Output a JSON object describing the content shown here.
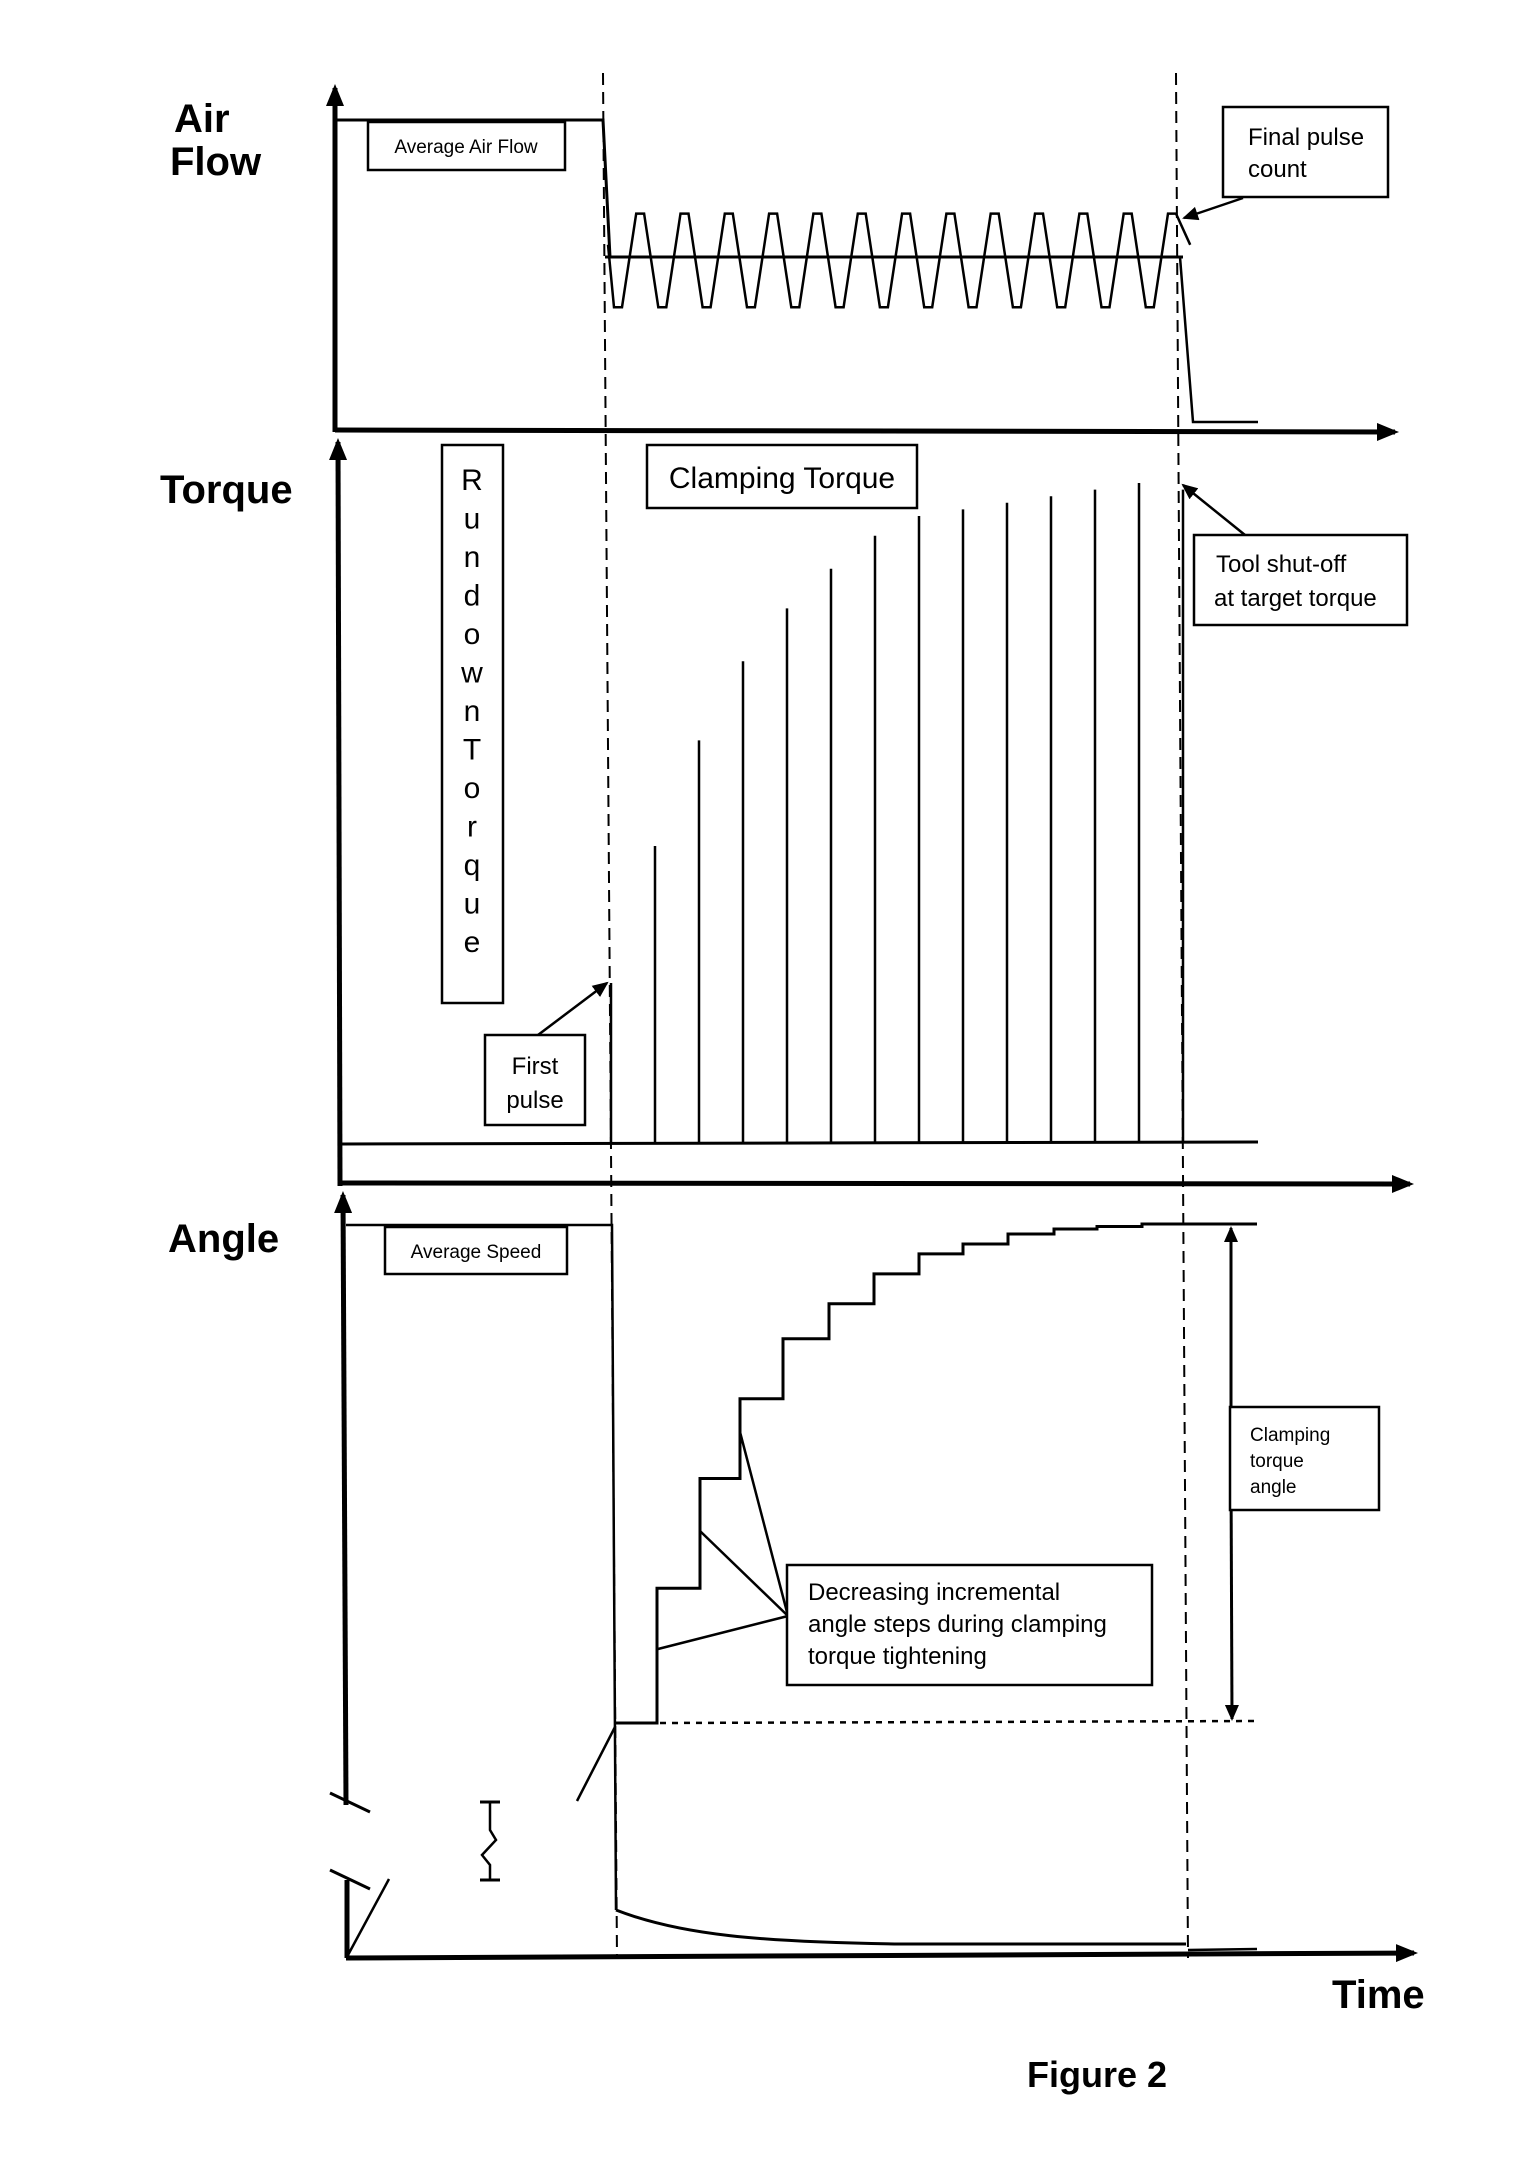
{
  "figure": {
    "caption": "Figure 2",
    "x_axis_label": "Time",
    "panels": {
      "air_flow": {
        "label_line1": "Air",
        "label_line2": "Flow",
        "annotation_average": "Average Air Flow",
        "annotation_final_line1": "Final pulse",
        "annotation_final_line2": "count"
      },
      "torque": {
        "label": "Torque",
        "annotation_rundown": "Rundown Torque",
        "annotation_clamping": "Clamping Torque",
        "annotation_first_line1": "First",
        "annotation_first_line2": "pulse",
        "annotation_shutoff_line1": "Tool shut-off",
        "annotation_shutoff_line2": "at target torque"
      },
      "angle": {
        "label": "Angle",
        "annotation_average": "Average Speed",
        "annotation_steps_line1": "Decreasing incremental",
        "annotation_steps_line2": "angle steps during clamping",
        "annotation_steps_line3": "torque tightening",
        "annotation_clamp_line1": "Clamping",
        "annotation_clamp_line2": "torque",
        "annotation_clamp_line3": "angle"
      }
    }
  },
  "chart_data": {
    "type": "line",
    "title": "Figure 2",
    "xlabel": "Time",
    "phases": [
      "rundown",
      "clamping",
      "shut-off"
    ],
    "series": [
      {
        "name": "Air Flow",
        "description": "Constant average air flow during rundown, then pulsed oscillation about a lower mean during clamping, dropping to zero at shut-off",
        "rundown_level": 1.0,
        "clamping_mean": 0.6,
        "clamping_peak": 0.7,
        "clamping_trough": 0.4,
        "pulse_count": 13,
        "after_shutoff": 0.02
      },
      {
        "name": "Torque",
        "description": "Low rundown torque, then discrete impulse pulses of increasing height during clamping up to target torque",
        "pulse_values": [
          0.0,
          0.45,
          0.61,
          0.73,
          0.81,
          0.87,
          0.92,
          0.95,
          0.96,
          0.97,
          0.98,
          0.99,
          1.0,
          0.99
        ],
        "pulse_count": 14
      },
      {
        "name": "Angle",
        "description": "Linear angle increase during rundown (axis broken), then staircase with decreasing incremental steps during clamping",
        "step_levels": [
          0.0,
          0.27,
          0.49,
          0.65,
          0.77,
          0.84,
          0.9,
          0.94,
          0.96,
          0.98,
          0.99,
          0.995,
          1.0
        ]
      },
      {
        "name": "Speed",
        "description": "Constant average speed during rundown, then decaying curve during clamping toward near zero",
        "rundown_level": 1.0,
        "clamping_start": 0.07,
        "clamping_end": 0.015
      }
    ]
  }
}
